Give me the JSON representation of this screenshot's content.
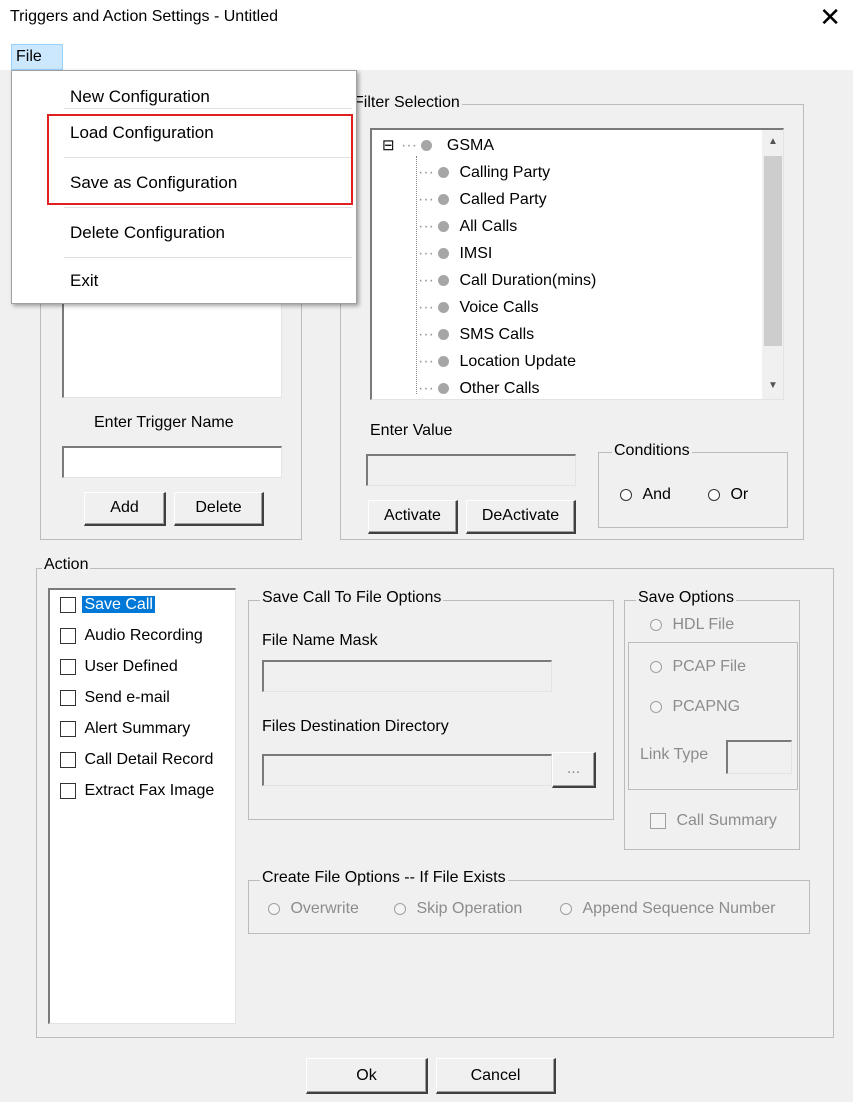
{
  "window": {
    "title": "Triggers and Action Settings - Untitled",
    "close_glyph": "✕"
  },
  "menubar": {
    "file": "File"
  },
  "file_menu": {
    "items": [
      "New Configuration",
      "Load Configuration",
      "Save as Configuration",
      "Delete Configuration",
      "Exit"
    ],
    "highlight_color": "#e02020"
  },
  "triggers": {
    "enter_trigger_name_label": "Enter Trigger Name",
    "trigger_name_value": "",
    "add_button": "Add",
    "delete_button": "Delete"
  },
  "filter": {
    "label": "Filter Selection",
    "root": "GSMA",
    "root_expander": "⊟",
    "children": [
      "Calling Party",
      "Called Party",
      "All Calls",
      "IMSI",
      "Call Duration(mins)",
      "Voice Calls",
      "SMS Calls",
      "Location Update",
      "Other Calls"
    ],
    "enter_value_label": "Enter Value",
    "enter_value": "",
    "activate_button": "Activate",
    "deactivate_button": "DeActivate",
    "conditions_label": "Conditions",
    "and_label": "And",
    "or_label": "Or",
    "scroll_up": "▲",
    "scroll_down": "▼"
  },
  "action": {
    "label": "Action",
    "items": [
      "Save Call",
      "Audio Recording",
      "User Defined",
      "Send e-mail",
      "Alert Summary",
      "Call Detail Record",
      "Extract Fax Image"
    ],
    "selected_index": 0,
    "selected_color": "#0078d7"
  },
  "save_call_options": {
    "label": "Save Call To File Options",
    "file_name_mask_label": "File Name Mask",
    "file_name_mask_value": "",
    "files_destination_label": "Files Destination Directory",
    "files_destination_value": "",
    "browse_button": "..."
  },
  "save_options": {
    "label": "Save Options",
    "hdl_file": "HDL File",
    "pcap_file": "PCAP File",
    "pcapng": "PCAPNG",
    "link_type_label": "Link Type",
    "link_type_value": "",
    "call_summary": "Call Summary"
  },
  "create_file_options": {
    "label": "Create File Options -- If File Exists",
    "overwrite": "Overwrite",
    "skip": "Skip Operation",
    "append": "Append Sequence Number"
  },
  "footer": {
    "ok": "Ok",
    "cancel": "Cancel"
  }
}
